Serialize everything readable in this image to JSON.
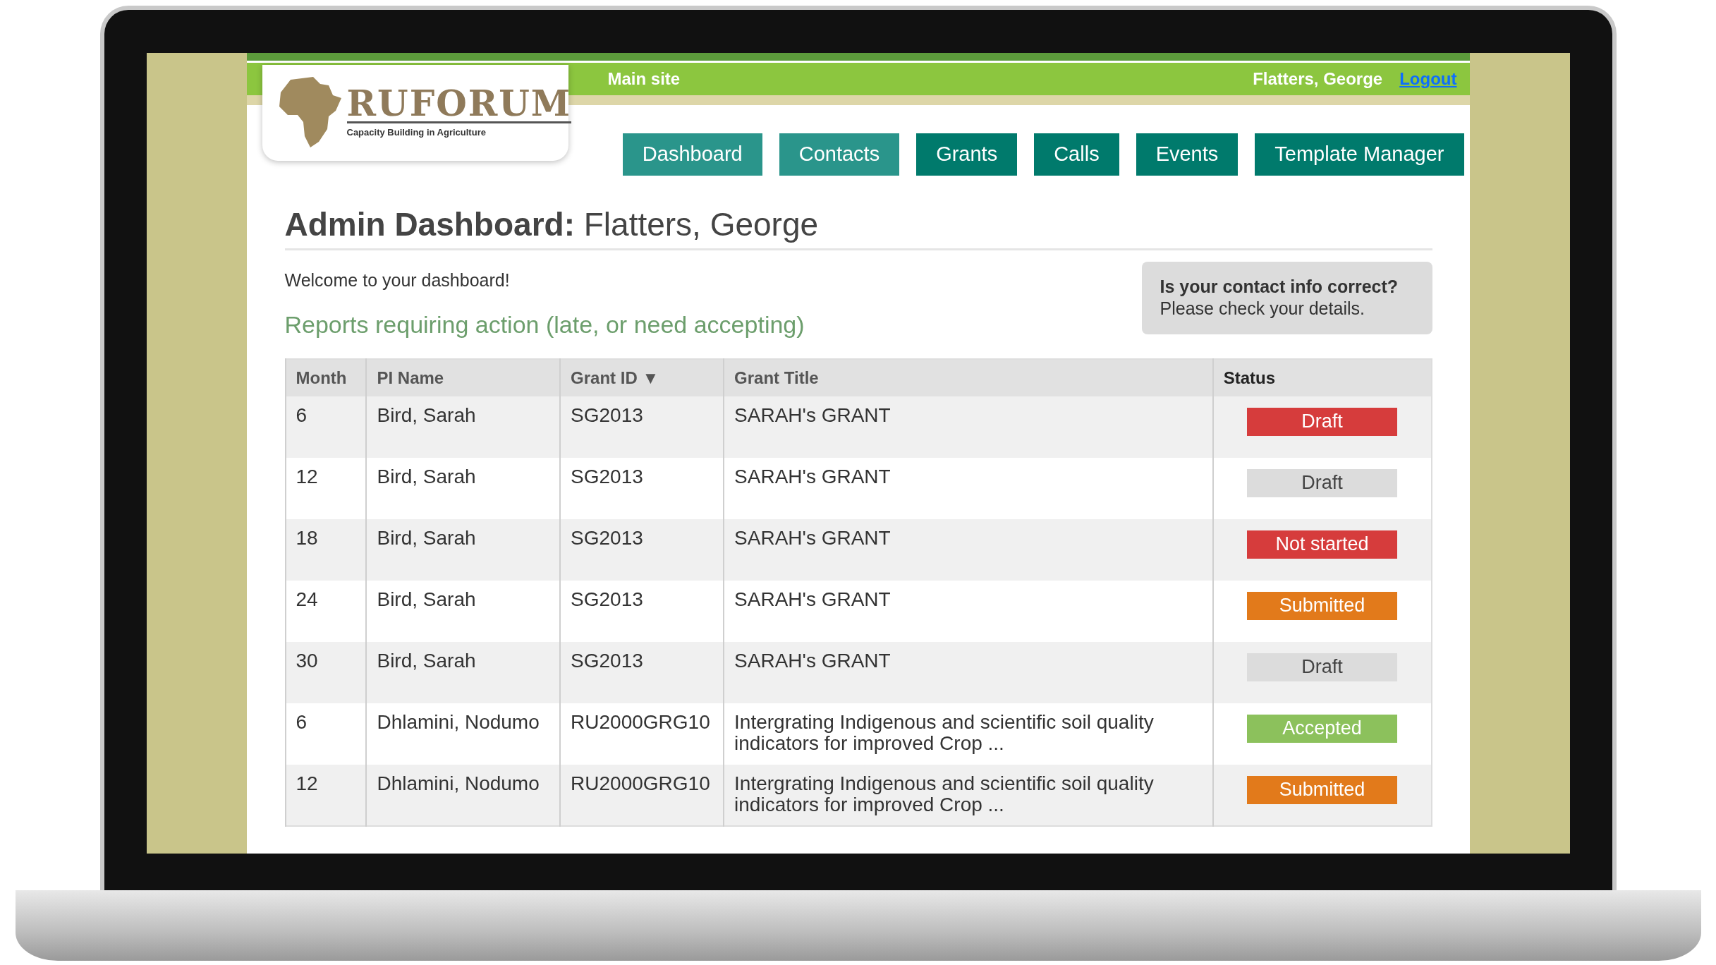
{
  "top_bar": {
    "main_site": "Main site",
    "user": "Flatters, George",
    "logout": "Logout"
  },
  "logo": {
    "name": "RUFORUM",
    "tagline": "Capacity Building in Agriculture"
  },
  "nav": [
    {
      "label": "Dashboard",
      "highlighted": true
    },
    {
      "label": "Contacts",
      "highlighted": true
    },
    {
      "label": "Grants",
      "highlighted": false
    },
    {
      "label": "Calls",
      "highlighted": false
    },
    {
      "label": "Events",
      "highlighted": false
    },
    {
      "label": "Template Manager",
      "highlighted": false
    }
  ],
  "heading": "**Admin Dashboard:** Flatters, George",
  "welcome": "Welcome to your dashboard!",
  "reports_heading": "Reports requiring action (late, or need accepting)",
  "contact_notice": {
    "title": "Is your contact info correct?",
    "text": "Please check your details."
  },
  "table": {
    "columns": [
      {
        "label": "Month"
      },
      {
        "label": "PI Name"
      },
      {
        "label": "Grant ID",
        "sort_indicator": "▼"
      },
      {
        "label": "Grant Title"
      },
      {
        "label": "Status"
      }
    ],
    "rows": [
      {
        "month": "6",
        "pi_name": "Bird, Sarah",
        "grant_id": "SG2013",
        "grant_title": "SARAH's GRANT",
        "status": {
          "label": "Draft",
          "color": "#d63c3c"
        }
      },
      {
        "month": "12",
        "pi_name": "Bird, Sarah",
        "grant_id": "SG2013",
        "grant_title": "SARAH's GRANT",
        "status": {
          "label": "Draft",
          "color": "#dcdcdc"
        }
      },
      {
        "month": "18",
        "pi_name": "Bird, Sarah",
        "grant_id": "SG2013",
        "grant_title": "SARAH's GRANT",
        "status": {
          "label": "Not started",
          "color": "#d63c3c"
        }
      },
      {
        "month": "24",
        "pi_name": "Bird, Sarah",
        "grant_id": "SG2013",
        "grant_title": "SARAH's GRANT",
        "status": {
          "label": "Submitted",
          "color": "#e27a1b"
        }
      },
      {
        "month": "30",
        "pi_name": "Bird, Sarah",
        "grant_id": "SG2013",
        "grant_title": "SARAH's GRANT",
        "status": {
          "label": "Draft",
          "color": "#dcdcdc"
        }
      },
      {
        "month": "6",
        "pi_name": "Dhlamini, Nodumo",
        "grant_id": "RU2000GRG10",
        "grant_title": "Intergrating Indigenous and scientific soil quality indicators for improved Crop ...",
        "status": {
          "label": "Accepted",
          "color": "#8cc15c"
        }
      },
      {
        "month": "12",
        "pi_name": "Dhlamini, Nodumo",
        "grant_id": "RU2000GRG10",
        "grant_title": "Intergrating Indigenous and scientific soil quality indicators for improved Crop ...",
        "status": {
          "label": "Submitted",
          "color": "#e27a1b"
        }
      }
    ]
  }
}
